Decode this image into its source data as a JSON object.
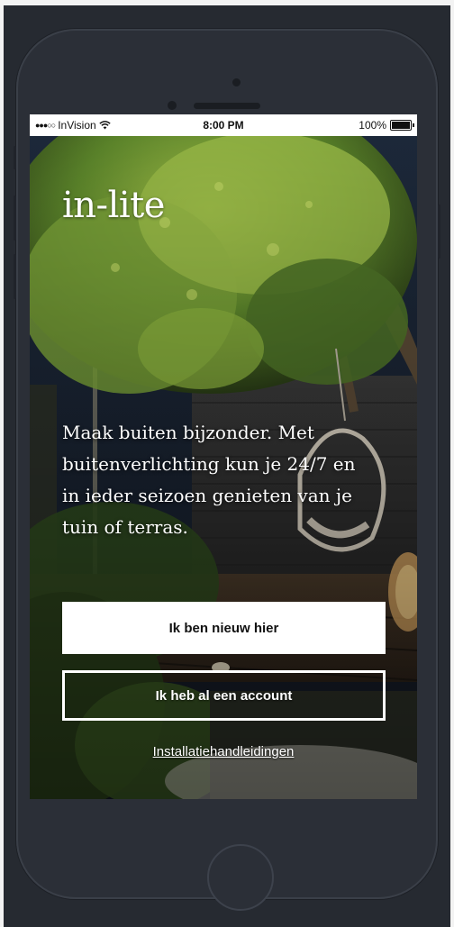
{
  "status_bar": {
    "signal": "●●●○○",
    "carrier": "InVision",
    "wifi_icon": "wifi-icon",
    "time": "8:00 PM",
    "battery": "100%"
  },
  "app": {
    "logo": "in-lite",
    "tagline": "Maak buiten bijzonder. Met buitenverlichting kun je 24/7 en in ieder seizoen genieten van je tuin of terras."
  },
  "actions": {
    "new_label": "Ik ben nieuw hier",
    "account_label": "Ik heb al een account",
    "manuals_label": "Installatiehandleidingen"
  },
  "colors": {
    "background": "#262a31",
    "phone_body": "#2b2f37",
    "button_primary_bg": "#ffffff",
    "text": "#ffffff"
  }
}
